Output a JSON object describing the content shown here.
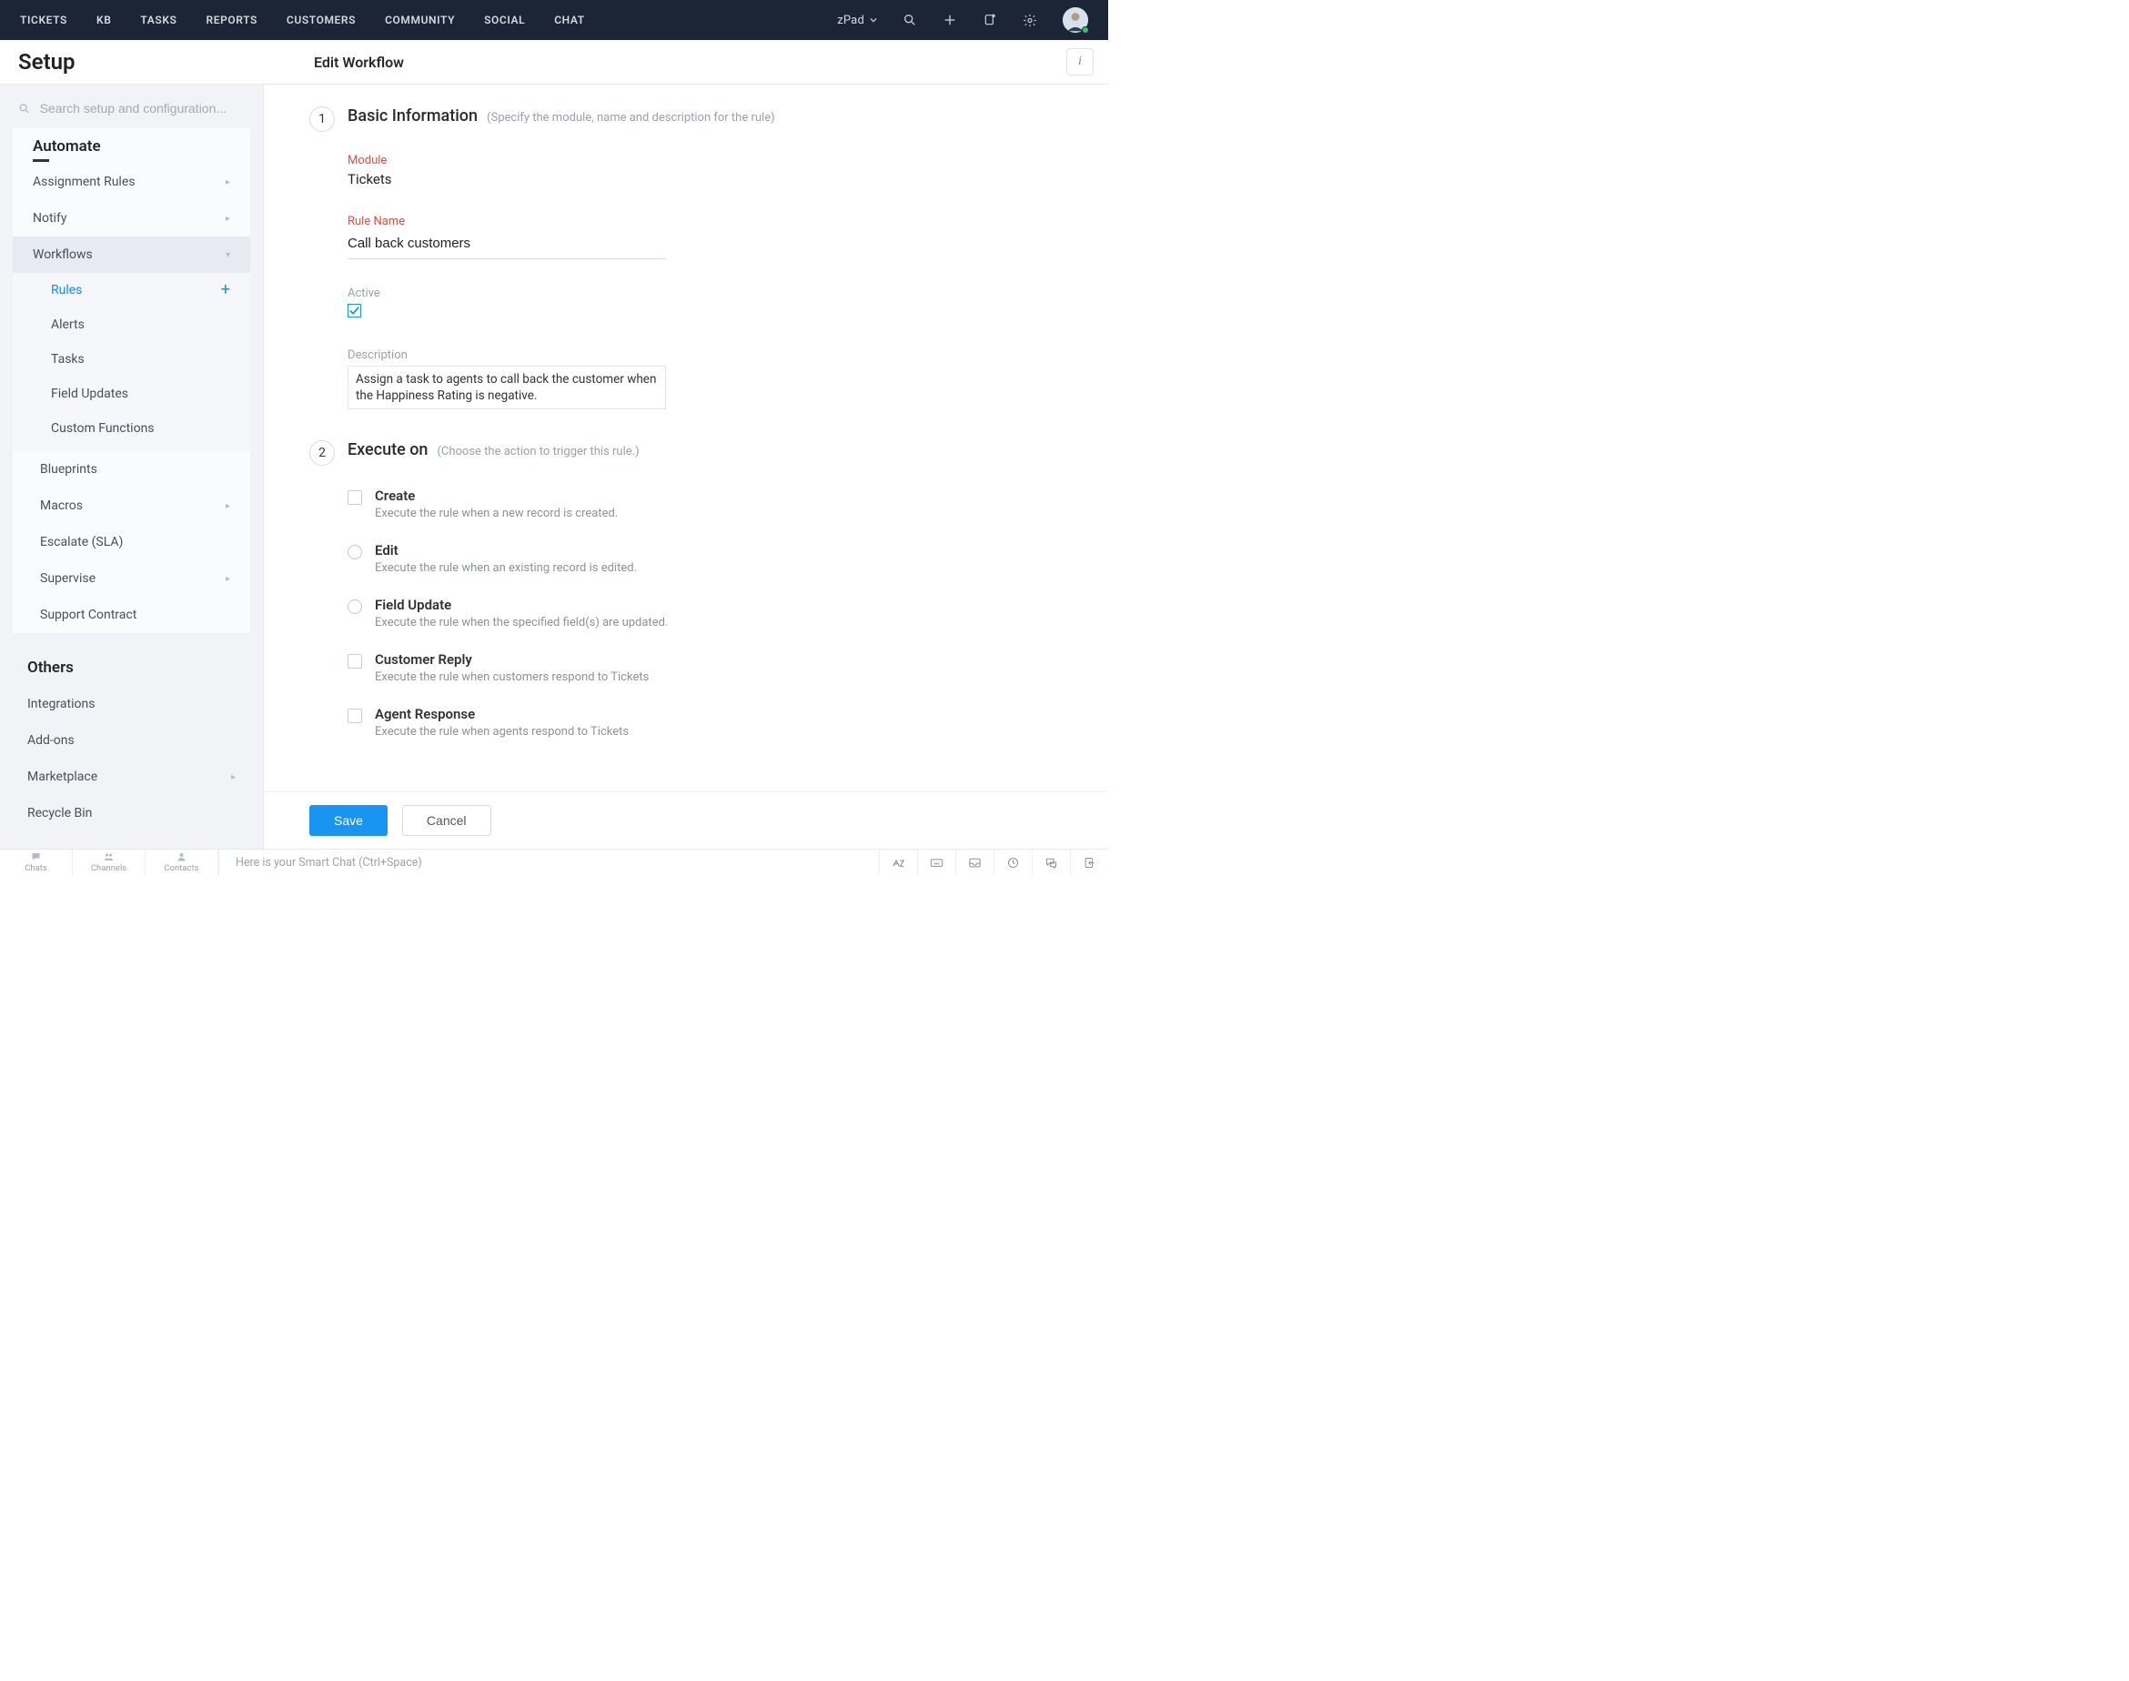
{
  "topnav": {
    "items": [
      "TICKETS",
      "KB",
      "TASKS",
      "REPORTS",
      "CUSTOMERS",
      "COMMUNITY",
      "SOCIAL",
      "CHAT"
    ],
    "brand": "zPad"
  },
  "subheader": {
    "setup": "Setup",
    "page_title": "Edit Workflow"
  },
  "sidebar": {
    "search_placeholder": "Search setup and configuration...",
    "automate_header": "Automate",
    "automate_items": {
      "assignment_rules": "Assignment Rules",
      "notify": "Notify",
      "workflows": "Workflows",
      "blueprints": "Blueprints",
      "macros": "Macros",
      "escalate": "Escalate (SLA)",
      "supervise": "Supervise",
      "support_contract": "Support Contract"
    },
    "workflow_sub": {
      "rules": "Rules",
      "alerts": "Alerts",
      "tasks": "Tasks",
      "field_updates": "Field Updates",
      "custom_functions": "Custom Functions"
    },
    "others_header": "Others",
    "others_items": {
      "integrations": "Integrations",
      "addons": "Add-ons",
      "marketplace": "Marketplace",
      "recycle_bin": "Recycle Bin"
    }
  },
  "form": {
    "step1_title": "Basic Information",
    "step1_sub": "(Specify the module, name and description for the rule)",
    "module_label": "Module",
    "module_value": "Tickets",
    "rule_name_label": "Rule Name",
    "rule_name_value": "Call back customers",
    "active_label": "Active",
    "description_label": "Description",
    "description_value": "Assign a task to agents to call back the customer when the Happiness Rating is negative.",
    "step2_title": "Execute on",
    "step2_sub": "(Choose the action to trigger this rule.)",
    "exec": [
      {
        "type": "check",
        "title": "Create",
        "desc": "Execute the rule when a new record is created."
      },
      {
        "type": "radio",
        "title": "Edit",
        "desc": "Execute the rule when an existing record is edited."
      },
      {
        "type": "radio",
        "title": "Field Update",
        "desc": "Execute the rule when the specified field(s) are updated."
      },
      {
        "type": "check",
        "title": "Customer Reply",
        "desc": "Execute the rule when customers respond to Tickets"
      },
      {
        "type": "check",
        "title": "Agent Response",
        "desc": "Execute the rule when agents respond to Tickets"
      }
    ],
    "save": "Save",
    "cancel": "Cancel"
  },
  "statusbar": {
    "tabs": {
      "chats": "Chats",
      "channels": "Channels",
      "contacts": "Contacts"
    },
    "smartchat": "Here is your Smart Chat (Ctrl+Space)"
  }
}
